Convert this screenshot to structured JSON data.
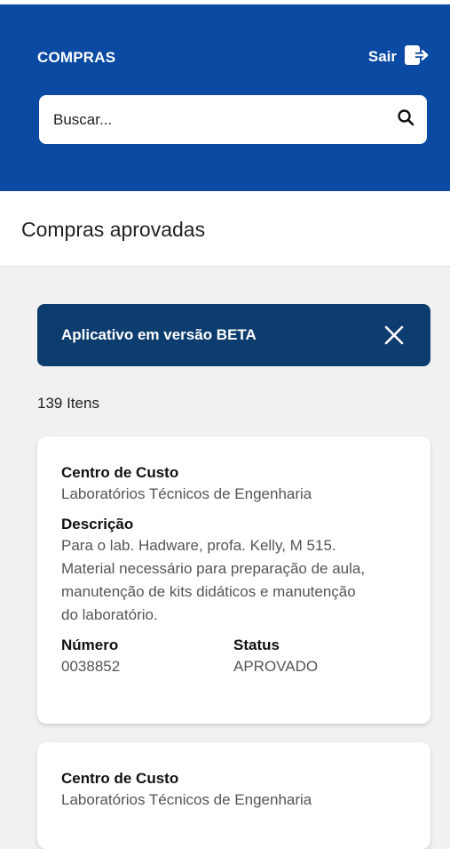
{
  "header": {
    "title": "COMPRAS",
    "logout_label": "Sair",
    "logout_icon": "logout-icon",
    "color": "#0b4aa2"
  },
  "search": {
    "placeholder": "Buscar...",
    "value": "",
    "icon": "search-icon"
  },
  "page": {
    "title": "Compras aprovadas"
  },
  "banner": {
    "text": "Aplicativo em versão BETA",
    "close_icon": "close-icon",
    "color": "#0d3c6e"
  },
  "list": {
    "count_label": "139 Itens",
    "items": [
      {
        "cost_center_label": "Centro de Custo",
        "cost_center": "Laboratórios Técnicos de Engenharia",
        "description_label": "Descrição",
        "description_lines": [
          "Para o lab. Hadware, profa. Kelly, M 515.",
          "Material necessário para preparação de aula,",
          "manutenção de kits didáticos e manutenção",
          "do laboratório."
        ],
        "number_label": "Número",
        "number": "0038852",
        "status_label": "Status",
        "status": "APROVADO"
      },
      {
        "cost_center_label": "Centro de Custo",
        "cost_center": "Laboratórios Técnicos de Engenharia"
      }
    ]
  }
}
